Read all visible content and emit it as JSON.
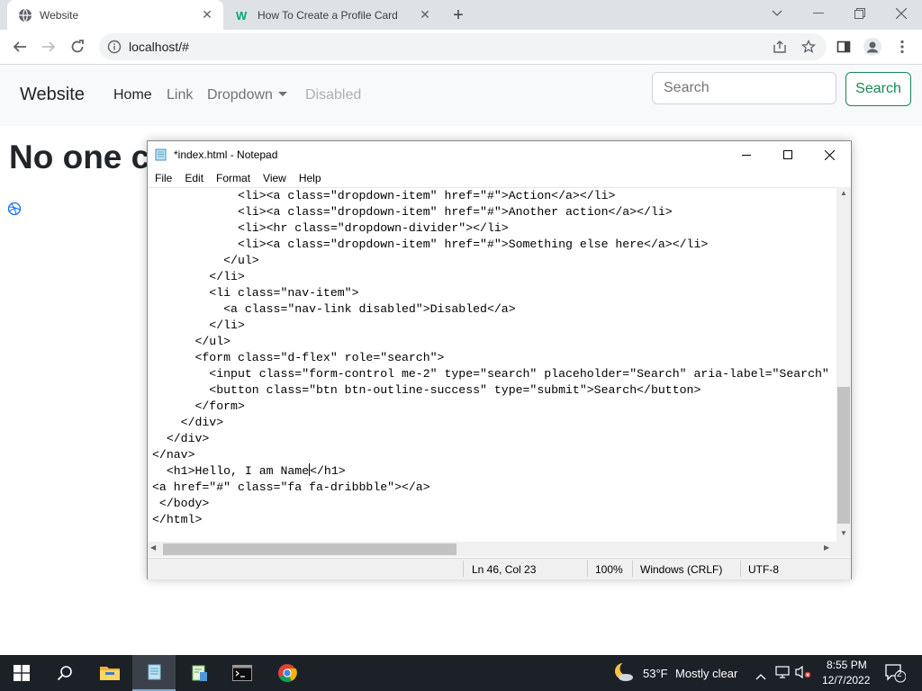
{
  "browser": {
    "tabs": [
      {
        "title": "Website",
        "active": true,
        "icon": "globe-icon"
      },
      {
        "title": "How To Create a Profile Card",
        "active": false,
        "icon": "w3schools-icon"
      }
    ],
    "new_tab_symbol": "+",
    "url": "localhost/#"
  },
  "website": {
    "brand": "Website",
    "nav": {
      "home": "Home",
      "link": "Link",
      "dropdown": "Dropdown",
      "disabled": "Disabled"
    },
    "search_placeholder": "Search",
    "search_button": "Search",
    "heading": "No one c"
  },
  "notepad": {
    "title": "*index.html - Notepad",
    "menu": [
      "File",
      "Edit",
      "Format",
      "View",
      "Help"
    ],
    "code_lines_before_cursor": "            <li><a class=\"dropdown-item\" href=\"#\">Action</a></li>\n            <li><a class=\"dropdown-item\" href=\"#\">Another action</a></li>\n            <li><hr class=\"dropdown-divider\"></li>\n            <li><a class=\"dropdown-item\" href=\"#\">Something else here</a></li>\n          </ul>\n        </li>\n        <li class=\"nav-item\">\n          <a class=\"nav-link disabled\">Disabled</a>\n        </li>\n      </ul>\n      <form class=\"d-flex\" role=\"search\">\n        <input class=\"form-control me-2\" type=\"search\" placeholder=\"Search\" aria-label=\"Search\"\n        <button class=\"btn btn-outline-success\" type=\"submit\">Search</button>\n      </form>\n    </div>\n  </div>\n</nav>\n  <h1>Hello, I am Name",
    "code_lines_after_cursor": "</h1>\n<a href=\"#\" class=\"fa fa-dribbble\"></a>\n </body>\n</html>",
    "status": {
      "position": "Ln 46, Col 23",
      "zoom": "100%",
      "line_ending": "Windows (CRLF)",
      "encoding": "UTF-8"
    }
  },
  "taskbar": {
    "weather_temp": "53°F",
    "weather_desc": "Mostly clear",
    "time": "8:55 PM",
    "date": "12/7/2022",
    "notification_count": "2"
  }
}
